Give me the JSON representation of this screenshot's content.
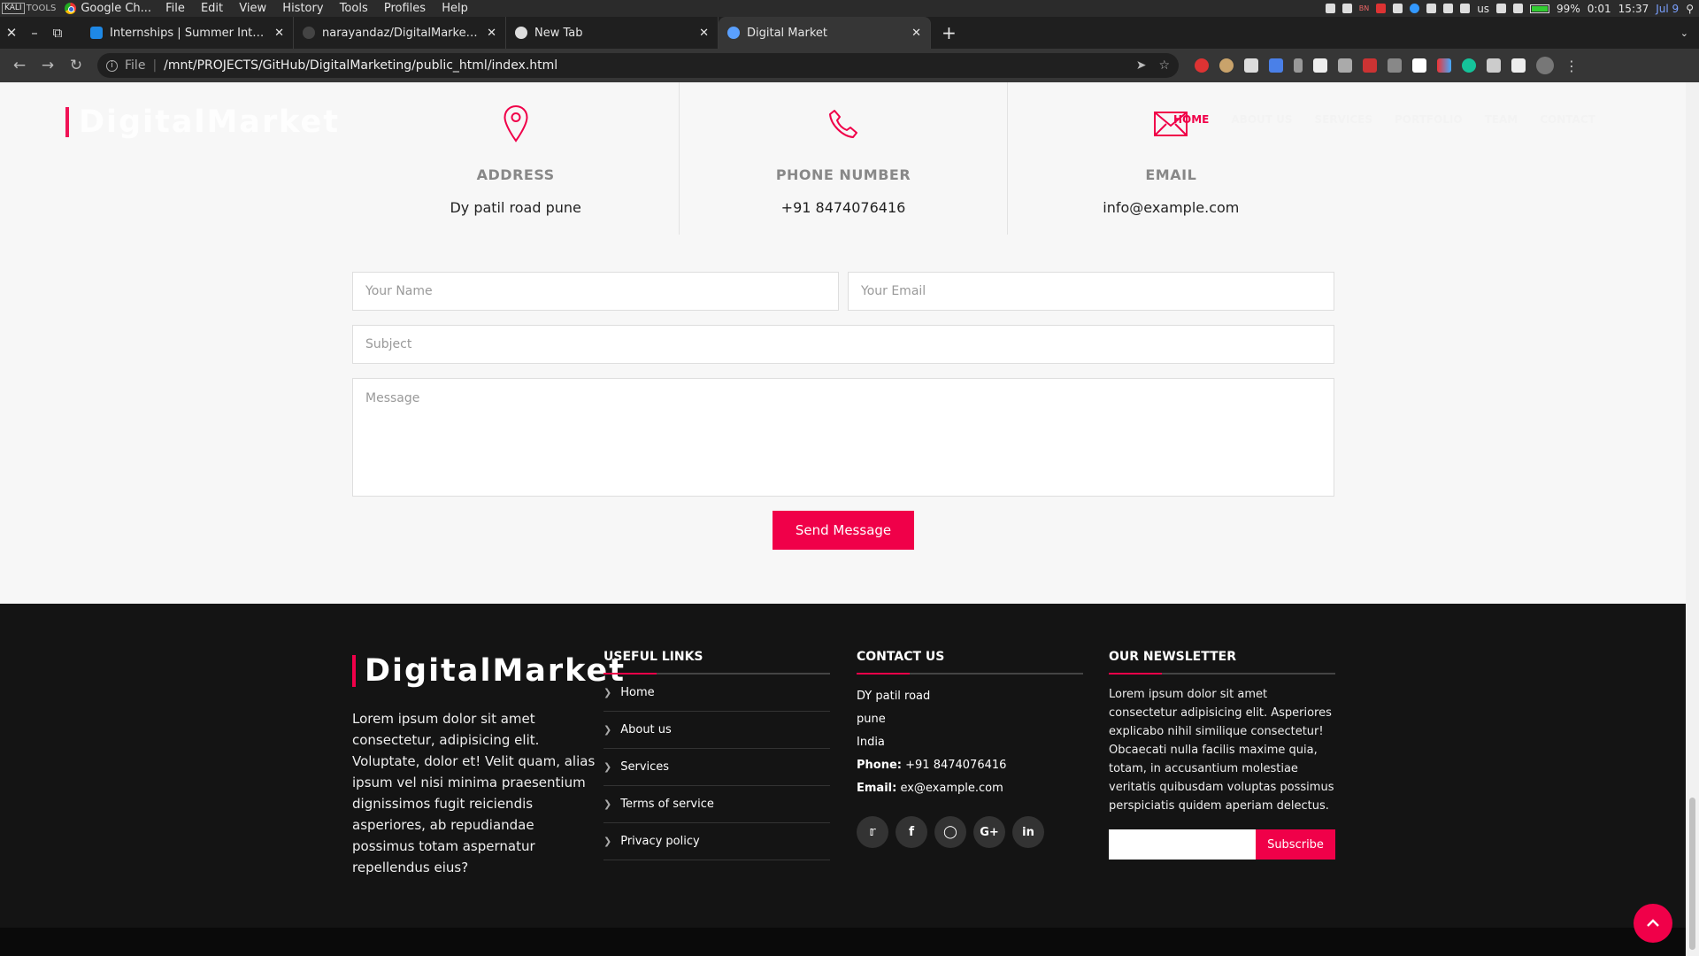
{
  "system_bar": {
    "kali_label": "KALI",
    "tools_label": "TOOLS",
    "app_name": "Google Ch...",
    "menu": [
      "File",
      "Edit",
      "View",
      "History",
      "Tools",
      "Profiles",
      "Help"
    ],
    "bn_label": "BN",
    "keyboard": "us",
    "battery": "99%",
    "battery_time": "0:01",
    "time": "15:37",
    "date": "Jul 9"
  },
  "tabs": [
    {
      "title": "Internships | Summer Intern",
      "favicon_color": "#1e88e5",
      "active": false
    },
    {
      "title": "narayandaz/DigitalMarketing",
      "favicon_color": "#444444",
      "active": false
    },
    {
      "title": "New Tab",
      "favicon_color": "#dddddd",
      "active": false
    },
    {
      "title": "Digital Market",
      "favicon_color": "#5aa0ff",
      "active": true
    }
  ],
  "address_bar": {
    "scheme_label": "File",
    "url": "/mnt/PROJECTS/GitHub/DigitalMarketing/public_html/index.html"
  },
  "site": {
    "brand": "DigitalMarket",
    "accent": "#f00049",
    "nav": [
      "HOME",
      "ABOUT US",
      "SERVICES",
      "PORTFOLIO",
      "TEAM",
      "CONTACT"
    ]
  },
  "contact_info": {
    "address": {
      "title": "ADDRESS",
      "value": "Dy patil road pune",
      "icon": "map-pin-icon"
    },
    "phone": {
      "title": "PHONE NUMBER",
      "value": "+91 8474076416",
      "icon": "phone-icon"
    },
    "email": {
      "title": "EMAIL",
      "value": "info@example.com",
      "icon": "envelope-icon"
    }
  },
  "form": {
    "name_placeholder": "Your Name",
    "email_placeholder": "Your Email",
    "subject_placeholder": "Subject",
    "message_placeholder": "Message",
    "send_label": "Send Message"
  },
  "footer": {
    "brand": "DigitalMarket",
    "about": "Lorem ipsum dolor sit amet consectetur, adipisicing elit. Voluptate, dolor et! Velit quam, alias ipsum vel nisi minima praesentium dignissimos fugit reiciendis asperiores, ab repudiandae possimus totam aspernatur repellendus eius?",
    "useful_links_title": "USEFUL LINKS",
    "useful_links": [
      "Home",
      "About us",
      "Services",
      "Terms of service",
      "Privacy policy"
    ],
    "contact_title": "CONTACT US",
    "contact_lines": [
      "DY patil road",
      "pune",
      "India"
    ],
    "phone_label": "Phone:",
    "phone": "+91 8474076416",
    "email_label": "Email:",
    "email": "ex@example.com",
    "socials": [
      "twitter-icon",
      "facebook-icon",
      "instagram-icon",
      "google-plus-icon",
      "linkedin-icon"
    ],
    "newsletter_title": "OUR NEWSLETTER",
    "newsletter_text": "Lorem ipsum dolor sit amet consectetur adipisicing elit. Asperiores explicabo nihil similique consectetur! Obcaecati nulla facilis maxime quia, totam, in accusantium molestiae veritatis quibusdam voluptas possimus perspiciatis quidem aperiam delectus.",
    "subscribe_label": "Subscribe"
  }
}
